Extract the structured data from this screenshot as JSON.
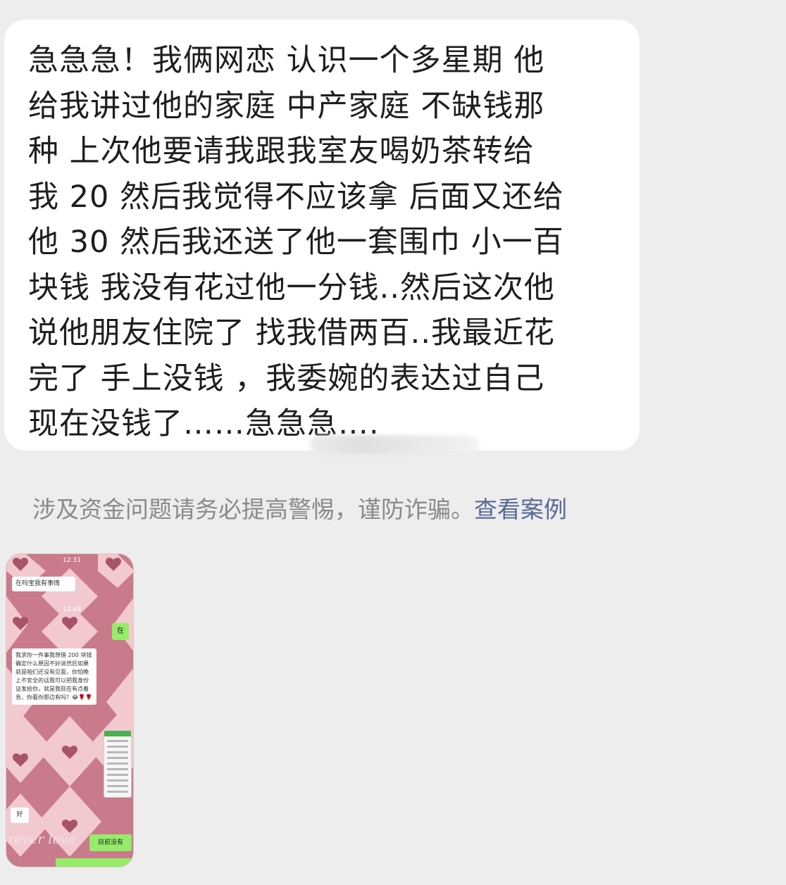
{
  "message": {
    "lines": [
      "急急急！我俩网恋 认识一个多星期 他",
      "给我讲过他的家庭 中产家庭 不缺钱那",
      "种 上次他要请我跟我室友喝奶茶转给",
      "我 20 然后我觉得不应该拿 后面又还给",
      "他 30 然后我还送了他一套围巾 小一百",
      "块钱 我没有花过他一分钱..然后这次他",
      "说他朋友住院了 找我借两百..我最近花",
      "完了 手上没钱 ，我委婉的表达过自己",
      "现在没钱了……急急急…."
    ]
  },
  "warning": {
    "text": "涉及资金问题请务必提高警惕，谨防诈骗。",
    "link": "查看案例"
  },
  "image_message": {
    "time1": "12:31",
    "msg1": "在吗宝我有事情",
    "time2": "12:49",
    "reply1": "在",
    "msg2": "我求你一件事我想借 200 块钱确定什么原因不好说然后如果就是咱们还没有见面，你怕晚上不安全的话我可以把我身份证发给你，就是我现在有点着急，你看你那边有吗？😂🌹🌹",
    "reply2": "好",
    "reply3": "目前没有",
    "script": "rever love"
  },
  "colors": {
    "background": "#ededed",
    "bubble": "#ffffff",
    "warning_text": "#8a8a8a",
    "link": "#576b95",
    "thumb_pink": "#c97a8b",
    "thumb_light": "#f2c9cf",
    "wechat_green": "#95ec69"
  }
}
